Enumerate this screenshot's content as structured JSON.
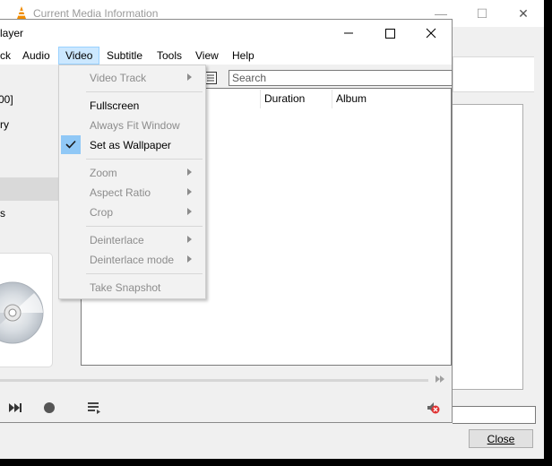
{
  "info_window": {
    "title": "Current Media Information",
    "close_button": "Close",
    "minimize_glyph": "—",
    "maximize_glyph": "☐",
    "close_glyph": "✕"
  },
  "vlc_window": {
    "title": "layer"
  },
  "menubar": {
    "items": [
      {
        "label": "ck"
      },
      {
        "label": "Audio"
      },
      {
        "label": "Video"
      },
      {
        "label": "Subtitle"
      },
      {
        "label": "Tools"
      },
      {
        "label": "View"
      },
      {
        "label": "Help"
      }
    ]
  },
  "sidebar": {
    "items": [
      {
        "label": "00]"
      },
      {
        "label": "ry"
      },
      {
        "label": "s"
      }
    ]
  },
  "playlist": {
    "search_placeholder": "Search",
    "columns": [
      "Duration",
      "Album"
    ]
  },
  "video_menu": {
    "items": [
      {
        "label": "Video Track",
        "enabled": false,
        "submenu": true
      },
      {
        "label": "Fullscreen",
        "enabled": true,
        "submenu": false
      },
      {
        "label": "Always Fit Window",
        "enabled": false,
        "submenu": false
      },
      {
        "label": "Set as Wallpaper",
        "enabled": true,
        "submenu": false,
        "checked": true
      },
      {
        "label": "Zoom",
        "enabled": false,
        "submenu": true
      },
      {
        "label": "Aspect Ratio",
        "enabled": false,
        "submenu": true
      },
      {
        "label": "Crop",
        "enabled": false,
        "submenu": true
      },
      {
        "label": "Deinterlace",
        "enabled": false,
        "submenu": true
      },
      {
        "label": "Deinterlace mode",
        "enabled": false,
        "submenu": true
      },
      {
        "label": "Take Snapshot",
        "enabled": false,
        "submenu": false
      }
    ]
  },
  "colors": {
    "menu_highlight": "#cce8ff",
    "check_highlight": "#90c8f6",
    "vlc_orange": "#f08c00"
  },
  "icons": [
    "vlc-cone-icon",
    "minimize-icon",
    "maximize-icon",
    "close-icon",
    "chevron-right-icon",
    "checkmark-icon",
    "list-view-icon",
    "next-track-icon",
    "record-icon",
    "playlist-icon",
    "mute-icon",
    "disc-art-icon"
  ]
}
